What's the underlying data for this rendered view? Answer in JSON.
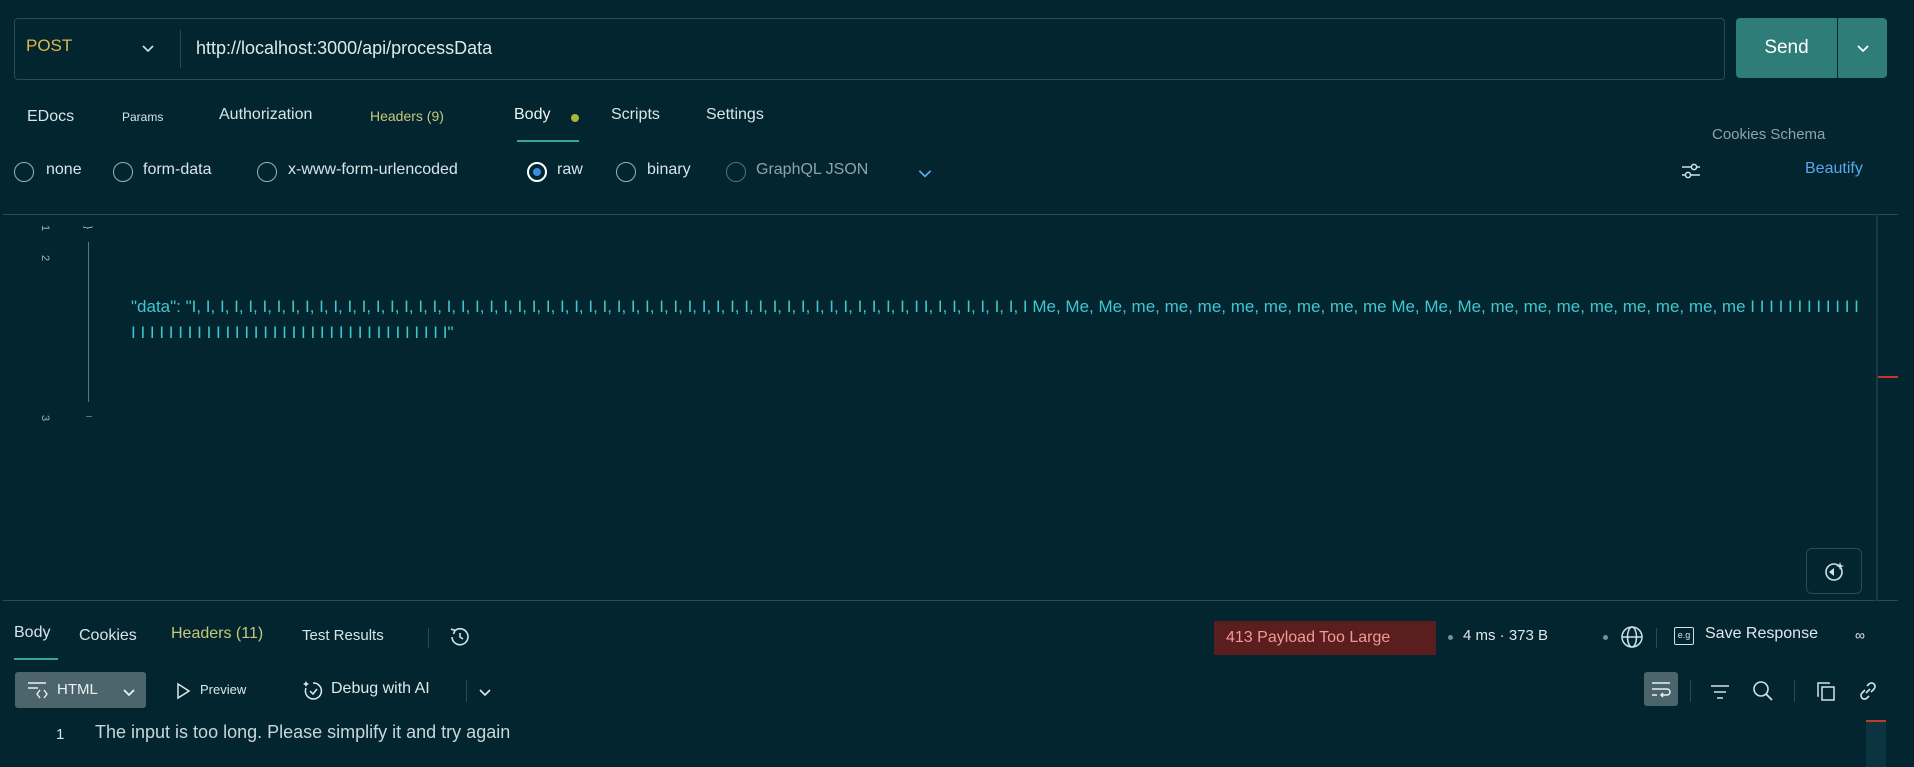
{
  "request": {
    "method": "POST",
    "url": "http://localhost:3000/api/processData",
    "send_label": "Send"
  },
  "tabs": {
    "docs": "EDocs",
    "params": "Params",
    "authorization": "Authorization",
    "headers": "Headers (9)",
    "body": "Body",
    "scripts": "Scripts",
    "settings": "Settings",
    "cookies_schema": "Cookies Schema"
  },
  "body_types": {
    "none": "none",
    "form_data": "form-data",
    "urlencoded": "x-www-form-urlencoded",
    "raw": "raw",
    "binary": "binary",
    "graphql": "GraphQL JSON",
    "selected": "raw",
    "beautify": "Beautify"
  },
  "editor": {
    "line_numbers": [
      "1",
      "2",
      "3"
    ],
    "fold_marker": "}",
    "code_line": "\"data\": \"I, I, I, I, I, I, I, I, I, I, I, I, I, I, I, I, I, I, I, I, I, I, I, I, I, I, I, I, I, I, I, I, I, I, I, I, I, I, I, I, I, I, I, I, I, I, I, I, I, I, I, I I, I, I, I, I, I, I, I Me, Me, Me, me, me, me, me, me, me, me, me Me, Me, Me, me, me, me, me, me, me, me, me I I I I I I I I I I I I I I I I I I I I I I I I I I I I I I I I I I I I I I I I I I I I I I\""
  },
  "response": {
    "tabs": {
      "body": "Body",
      "cookies": "Cookies",
      "headers": "Headers (11)",
      "test_results": "Test Results"
    },
    "status": "413 Payload Too Large",
    "timing": "4 ms · 373 B",
    "save_response": "Save Response",
    "save_icon_text": "e.g",
    "more": "∞",
    "format": "HTML",
    "preview": "Preview",
    "debug_ai": "Debug with AI",
    "output_line_number": "1",
    "output_text": "The input is too long. Please simplify it and try again"
  },
  "colors": {
    "background": "#022530",
    "accent": "#2f7d78",
    "method": "#e0b64a",
    "code": "#3fc7cf",
    "error_bg": "#5a1e1e",
    "error_text": "#f09a96"
  },
  "icons": [
    "chevron-down-icon",
    "sliders-icon",
    "ai-sparkle-icon",
    "history-icon",
    "globe-icon",
    "save-icon",
    "more-icon",
    "code-format-icon",
    "play-icon",
    "debug-ai-icon",
    "wrap-icon",
    "filter-icon",
    "search-icon",
    "copy-icon",
    "link-icon"
  ]
}
